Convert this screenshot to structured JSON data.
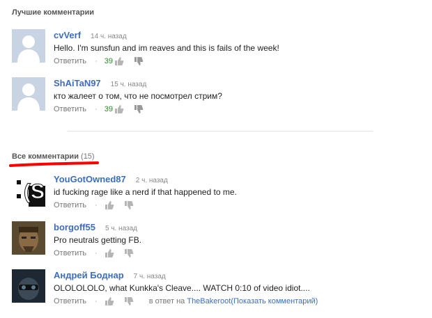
{
  "best": {
    "title": "Лучшие комментарии",
    "comments": [
      {
        "author": "cvVerf",
        "time": "14 ч. назад",
        "text": "Hello. I'm sunsfun and im reaves and this is fails of the week!",
        "reply": "Ответить",
        "likes": "39"
      },
      {
        "author": "ShAiTaN97",
        "time": "15 ч. назад",
        "text": "кто жалеет о том, что не посмотрел стрим?",
        "reply": "Ответить",
        "likes": "39"
      }
    ]
  },
  "all": {
    "title": "Все комментарии",
    "count": "(15)",
    "comments": [
      {
        "author": "YouGotOwned87",
        "time": "2 ч. назад",
        "text": "id fucking rage like a nerd if that happened to me.",
        "reply": "Ответить"
      },
      {
        "author": "borgoff55",
        "time": "5 ч. назад",
        "text": "Pro neutrals getting FB.",
        "reply": "Ответить"
      },
      {
        "author": "Андрей Боднар",
        "time": "7 ч. назад",
        "text": "OLOLOLOLO, what Kunkka's Cleave.... WATCH 0:10 of video idiot....",
        "reply": "Ответить",
        "in_reply_prefix": "в ответ на",
        "in_reply_user": "TheBakeroot",
        "show_comment": "(Показать комментарий)"
      }
    ]
  },
  "colors": {
    "link": "#3d6dba",
    "likes": "#2a8a2a",
    "underline": "#ff0000"
  },
  "icons": [
    "default-avatar-icon",
    "thumbs-up-icon",
    "thumbs-down-icon"
  ]
}
